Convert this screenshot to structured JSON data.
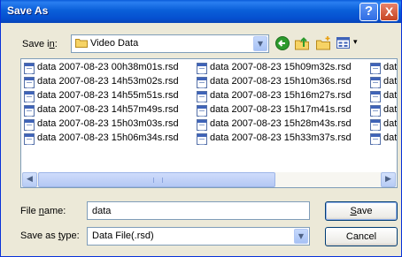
{
  "dialog": {
    "title": "Save As"
  },
  "title_buttons": {
    "help": "?",
    "close": "X"
  },
  "save_in": {
    "label": "Save in:",
    "accesskey": "i",
    "value": "Video Data"
  },
  "toolbar": {
    "view_menu_arrow": "▾"
  },
  "files": {
    "columns": [
      [
        "data 2007-08-23 00h38m01s.rsd",
        "data 2007-08-23 14h53m02s.rsd",
        "data 2007-08-23 14h55m51s.rsd",
        "data 2007-08-23 14h57m49s.rsd",
        "data 2007-08-23 15h03m03s.rsd",
        "data 2007-08-23 15h06m34s.rsd"
      ],
      [
        "data 2007-08-23 15h09m32s.rsd",
        "data 2007-08-23 15h10m36s.rsd",
        "data 2007-08-23 15h16m27s.rsd",
        "data 2007-08-23 15h17m41s.rsd",
        "data 2007-08-23 15h28m43s.rsd",
        "data 2007-08-23 15h33m37s.rsd"
      ],
      [
        "dat",
        "dat",
        "dat",
        "dat",
        "dat",
        "dat"
      ]
    ]
  },
  "scrollbar": {
    "left_arrow": "◀",
    "right_arrow": "▶"
  },
  "file_name": {
    "label": "File name:",
    "value": "data"
  },
  "save_as_type": {
    "label": "Save as type:",
    "value": "Data File(.rsd)"
  },
  "buttons": {
    "save": "Save",
    "cancel": "Cancel"
  },
  "combo_arrow": "▼",
  "icons": [
    "folder-icon",
    "back-icon",
    "up-folder-icon",
    "new-folder-icon",
    "view-menu-icon",
    "file-icon",
    "help-icon",
    "close-icon"
  ],
  "colors": {
    "titlebar": "#0a5fd9",
    "dialog_bg": "#ece9d8",
    "field_border": "#7f9db9",
    "close": "#c64422"
  }
}
